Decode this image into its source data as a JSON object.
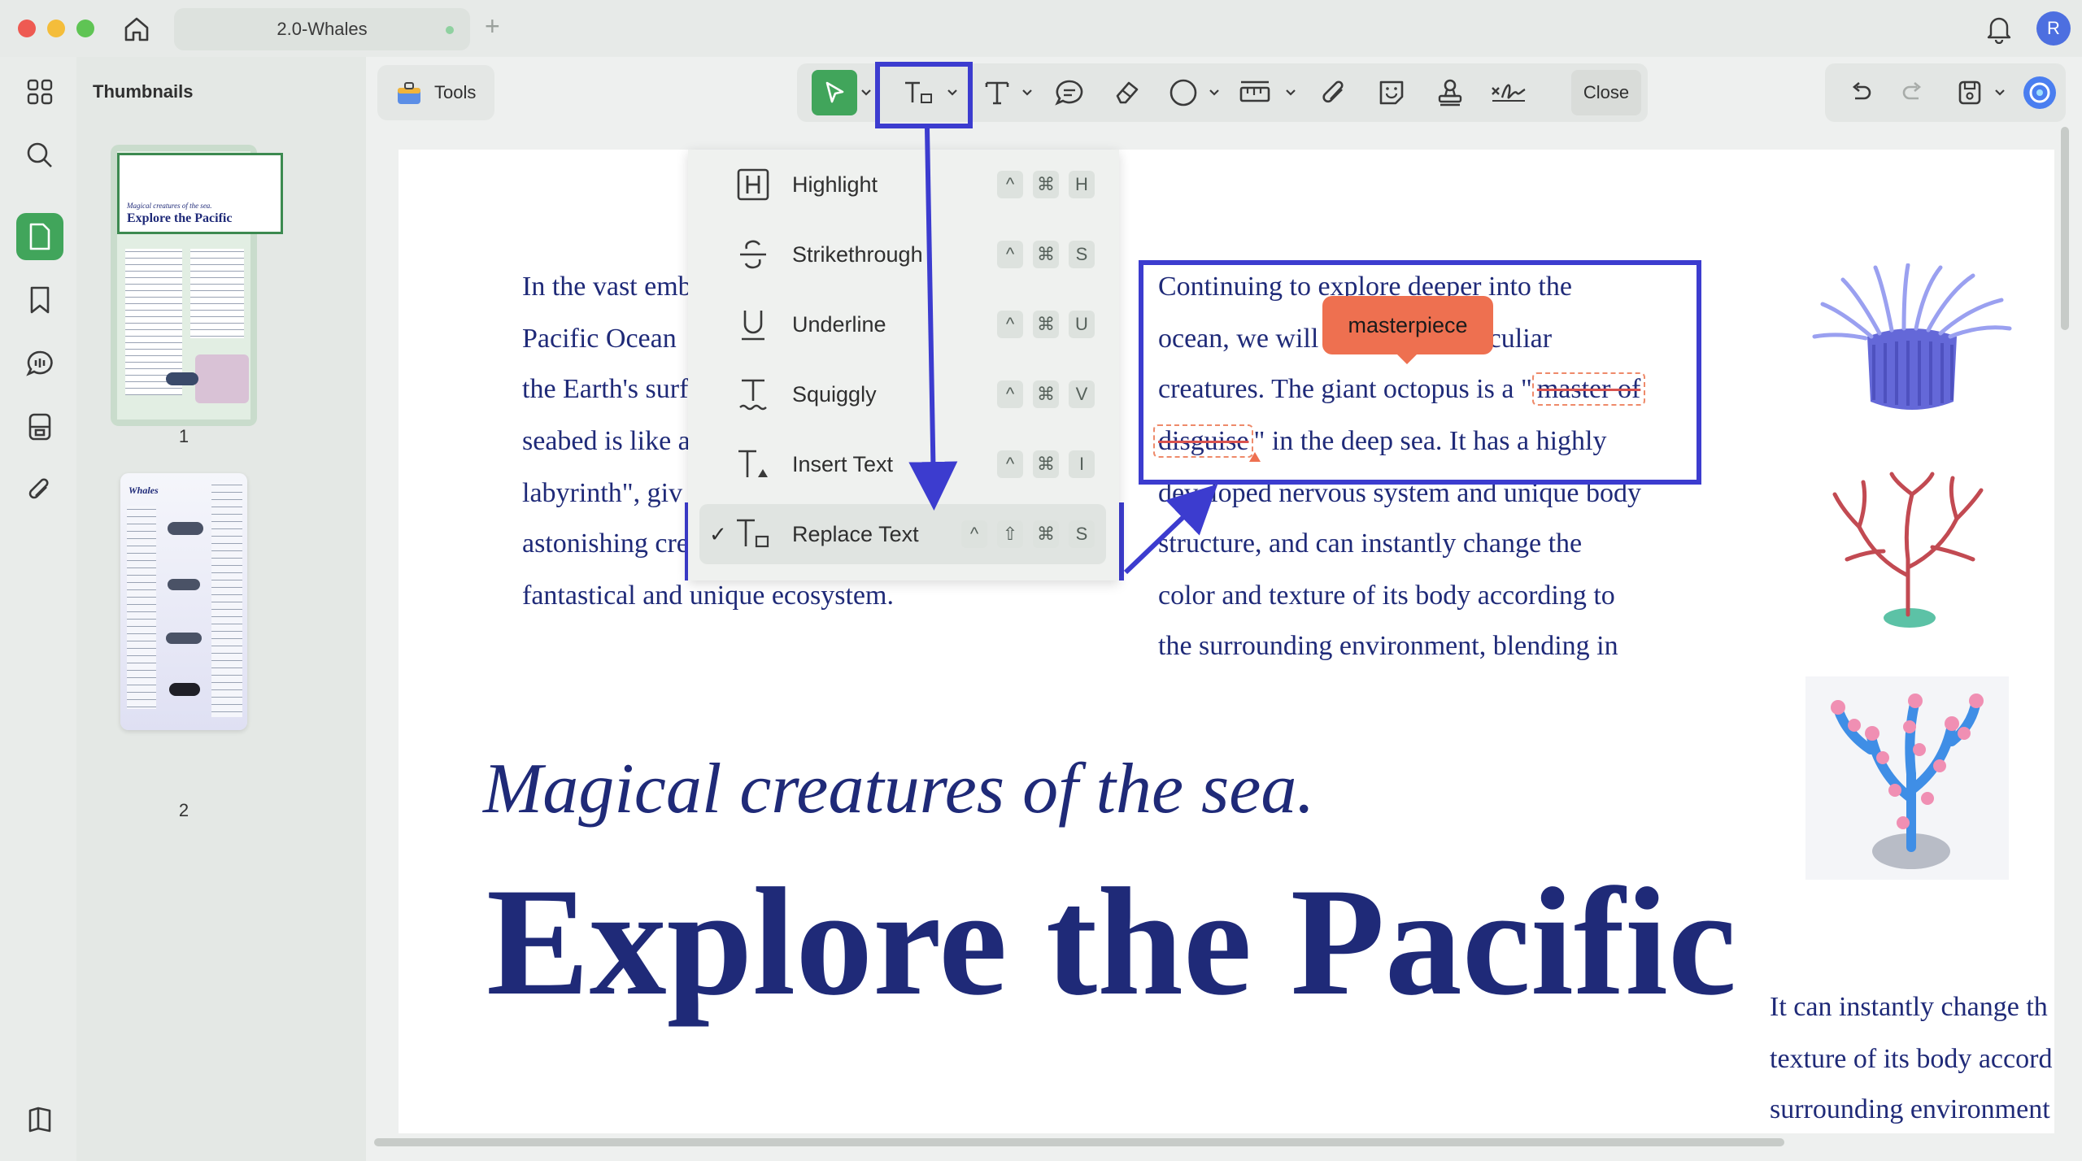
{
  "window": {
    "tab_title": "2.0-Whales",
    "new_tab_symbol": "+",
    "avatar_initial": "R"
  },
  "sidebar": {
    "heading": "Thumbnails",
    "pages": [
      {
        "number": "1",
        "mini_title_line1": "Magical creatures of the sea.",
        "mini_title_line2": "Explore the Pacific"
      },
      {
        "number": "2",
        "mini_title_line1": "Whales"
      }
    ]
  },
  "toolbar": {
    "tools_label": "Tools",
    "close_label": "Close"
  },
  "markup_menu": {
    "items": [
      {
        "label": "Highlight",
        "keys": [
          "^",
          "⌘",
          "H"
        ],
        "icon": "highlight-icon"
      },
      {
        "label": "Strikethrough",
        "keys": [
          "^",
          "⌘",
          "S"
        ],
        "icon": "strikethrough-icon"
      },
      {
        "label": "Underline",
        "keys": [
          "^",
          "⌘",
          "U"
        ],
        "icon": "underline-icon"
      },
      {
        "label": "Squiggly",
        "keys": [
          "^",
          "⌘",
          "V"
        ],
        "icon": "squiggly-icon"
      },
      {
        "label": "Insert Text",
        "keys": [
          "^",
          "⌘",
          "I"
        ],
        "icon": "insert-text-icon"
      },
      {
        "label": "Replace Text",
        "keys": [
          "^",
          "⇧",
          "⌘",
          "S"
        ],
        "icon": "replace-text-icon",
        "checked": "✓"
      }
    ]
  },
  "document": {
    "left_column": [
      "In the vast emb",
      "Pacific Ocean",
      "the Earth's surf",
      "seabed is like a",
      "labyrinth\", giv",
      "astonishing cre",
      "fantastical and unique ecosystem."
    ],
    "middle_column": {
      "line1": "Continuing to explore deeper into the",
      "line2_a": "ocean, we will",
      "line2_b": "he peculiar",
      "line3_a": "creatures. The giant octopus is a \"",
      "line3_struck": "master of",
      "line4_struck": "disguise",
      "line4_b": "\" in the deep sea. It has a highly",
      "line5": "developed nervous system and unique body",
      "line6": "structure, and can instantly change the",
      "line7": "color and texture of its body according to",
      "line8": "the surrounding environment, blending in"
    },
    "right_column": [
      "It can instantly change th",
      "texture of its body accord",
      "surrounding environment"
    ],
    "italic_title": "Magical creatures of the sea.",
    "big_title": "Explore the Pacific",
    "replacement_tooltip": "masterpiece"
  },
  "colors": {
    "accent_green": "#41a55b",
    "annotation_blue": "#3c3ccf",
    "doc_text": "#1f2a78",
    "tooltip": "#ee7050"
  }
}
